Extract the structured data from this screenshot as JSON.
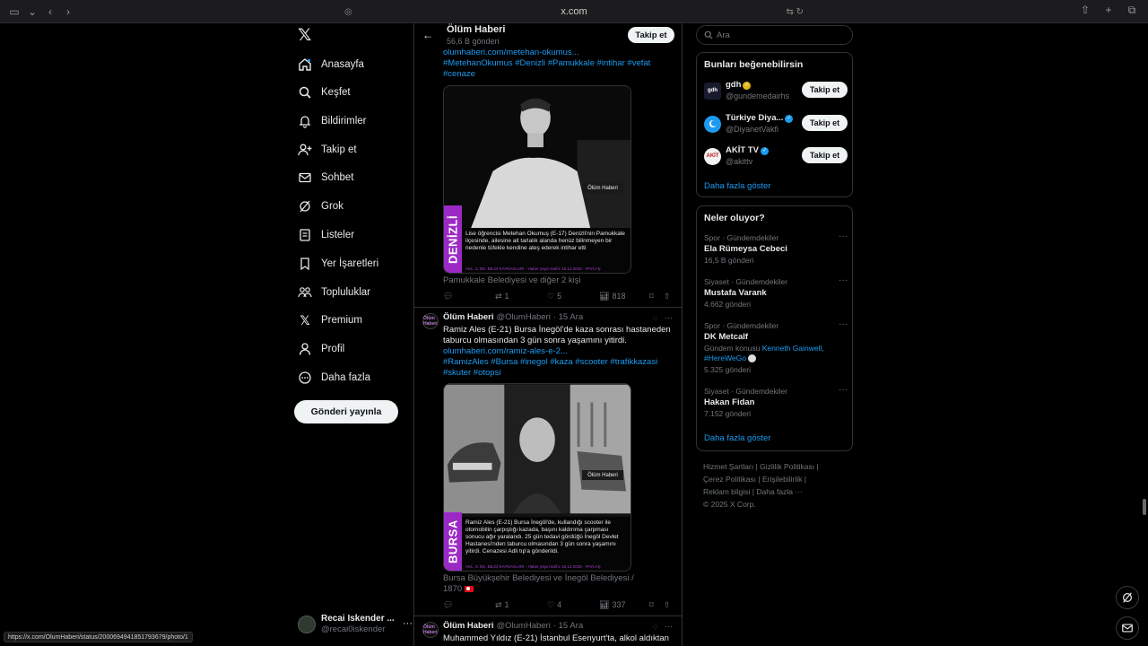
{
  "browser": {
    "url": "x.com",
    "status_url": "https://x.com/OlumHaberi/status/2000694941851793679/photo/1"
  },
  "nav": {
    "items": [
      {
        "label": "Anasayfa",
        "icon": "home-icon"
      },
      {
        "label": "Keşfet",
        "icon": "search-icon"
      },
      {
        "label": "Bildirimler",
        "icon": "bell-icon"
      },
      {
        "label": "Takip et",
        "icon": "person-add-icon"
      },
      {
        "label": "Sohbet",
        "icon": "mail-icon"
      },
      {
        "label": "Grok",
        "icon": "grok-icon"
      },
      {
        "label": "Listeler",
        "icon": "list-icon"
      },
      {
        "label": "Yer İşaretleri",
        "icon": "bookmark-icon"
      },
      {
        "label": "Topluluklar",
        "icon": "communities-icon"
      },
      {
        "label": "Premium",
        "icon": "x-logo-icon"
      },
      {
        "label": "Profil",
        "icon": "person-icon"
      },
      {
        "label": "Daha fazla",
        "icon": "more-circle-icon"
      }
    ],
    "post_button": "Gönderi yayınla",
    "account": {
      "name": "Recai Iskender ...",
      "handle": "@recai0iskender",
      "more": "···"
    }
  },
  "header": {
    "title": "Ölüm Haberi",
    "subtitle": "56,6 B gönderi",
    "follow": "Takip et"
  },
  "tweet1": {
    "link": "olumhaberi.com/metehan-okumus...",
    "hashtags_line1": "#MetehanOkumus #Denizli #Pamukkale #intihar #vefat",
    "hashtags_line2": "#cenaze",
    "media": {
      "city": "DENİZLİ",
      "caption": "Lise öğrencisi Metehan Okumuş (E-17) Denizli'nin Pamukkale ilçesinde, ailesine ait tarlalık alanda henüz bilinmeyen bir nedenle tüfekle kendine ateş ederek intihar etti",
      "brand": "Ölüm Haberi",
      "footer": "AKL. 3. DK. BİLGİ KAYNAKLARI · Haber yayın tarihi: 15.12.2025 · PAYLAŞ"
    },
    "tagged": "Pamukkale Belediyesi ve diğer 2 kişi",
    "stats": {
      "replies": "",
      "reposts": "1",
      "likes": "5",
      "views": "818"
    }
  },
  "tweet2": {
    "name": "Ölüm Haberi",
    "handle": "@OlumHaberi",
    "date": "· 15 Ara",
    "avatar_text": "Ölüm Haberi",
    "text_line1": "Ramiz Ales (E-21) Bursa İnegöl'de kaza sonrası hastaneden",
    "text_line2": "taburcu olmasından 3 gün sonra yaşamını yitirdi.",
    "link": "olumhaberi.com/ramiz-ales-e-2...",
    "hashtags_line1": "#RamizAles #Bursa #inegol #kaza #scooter #trafikkazasi",
    "hashtags_line2": "#skuter #otopsi",
    "media": {
      "city": "BURSA",
      "caption": "Ramiz Ales (E-21) Bursa İnegöl'de, kullandığı scooter ile otomobilin çarpıştığı kazada, başını kaldırıma çarpması sonucu ağır yaralandı. 25 gün tedavi gördüğü İnegöl Devlet Hastanesi'nden taburcu olmasından 3 gün sonra yaşamını yitirdi. Cenazesi Adli tıp'a gönderildi.",
      "brand": "Ölüm Haberi",
      "footer": "AKL. 3. DK. BİLGİ KAYNAKLARI · Haber yayın tarihi: 15.12.2025 · PAYLAŞ"
    },
    "tagged_line1": "Bursa Büyükşehir Belediyesi ve İnegöl Belediyesi /",
    "tagged_line2": "1870",
    "stats": {
      "replies": "",
      "reposts": "1",
      "likes": "4",
      "views": "337"
    }
  },
  "tweet3": {
    "name": "Ölüm Haberi",
    "handle": "@OlumHaberi",
    "date": "· 15 Ara",
    "avatar_text": "Ölüm Haberi",
    "text_line1": "Muhammed Yıldız (E-21) İstanbul Esenyurt'ta, alkol aldıktan"
  },
  "search": {
    "placeholder": "Ara"
  },
  "suggestions": {
    "title": "Bunları beğenebilirsin",
    "items": [
      {
        "name": "gdh",
        "handle": "@gundemedairhs",
        "button": "Takip et",
        "avatar": "gdh"
      },
      {
        "name": "Türkiye Diya...",
        "handle": "@DiyanetVakfi",
        "button": "Takip et",
        "avatar": ""
      },
      {
        "name": "AKİT TV",
        "handle": "@akittv",
        "button": "Takip et",
        "avatar": "AKİT"
      }
    ],
    "more": "Daha fazla göster"
  },
  "trends": {
    "title": "Neler oluyor?",
    "items": [
      {
        "category": "Spor · Gündemdekiler",
        "name": "Ela Rümeysa Cebeci",
        "count": "16,5 B gönderi"
      },
      {
        "category": "Siyaset · Gündemdekiler",
        "name": "Mustafa Varank",
        "count": "4.662 gönderi"
      },
      {
        "category": "Spor · Gündemdekiler",
        "name": "DK Metcalf",
        "context_prefix": "Gündem konusu ",
        "context_link": "Kenneth Gainwell,",
        "context_link2": "#HereWeGo",
        "count": "5.325 gönderi"
      },
      {
        "category": "Siyaset · Gündemdekiler",
        "name": "Hakan Fidan",
        "count": "7.152 gönderi"
      }
    ],
    "more": "Daha fazla göster"
  },
  "footer": {
    "line1": "Hizmet Şartları  |  Gizlilik Politikası  |",
    "line2": "Çerez Politikası  |  Erişilebilirlik  |",
    "line3": "Reklam bilgisi  |  Daha fazla ···",
    "line4": "© 2025 X Corp."
  }
}
